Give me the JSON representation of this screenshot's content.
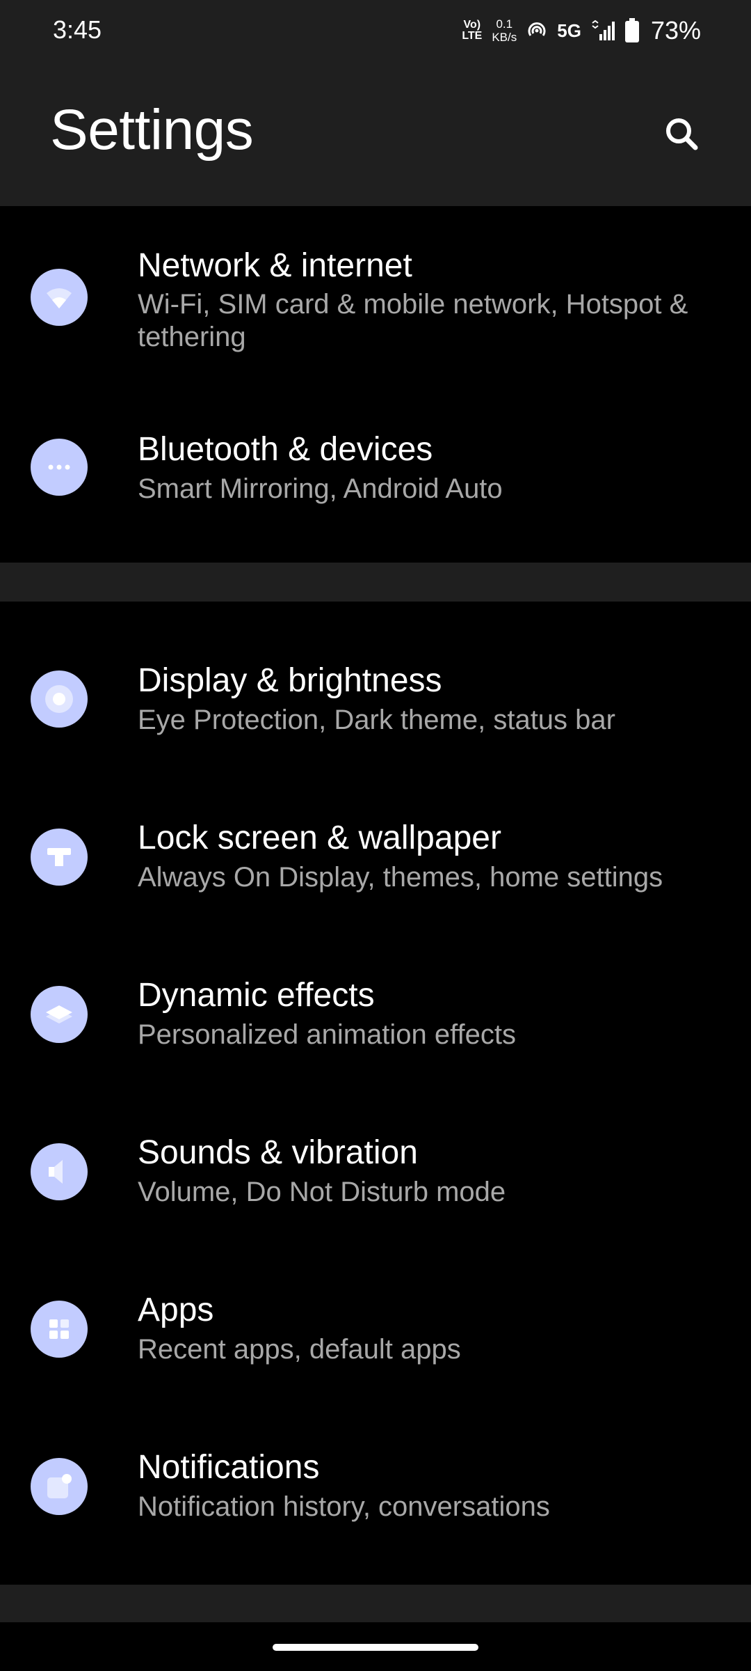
{
  "status_bar": {
    "time": "3:45",
    "volte_top": "Vo)",
    "volte_bottom": "LTE",
    "speed_value": "0.1",
    "speed_unit": "KB/s",
    "network": "5G",
    "battery": "73%"
  },
  "header": {
    "title": "Settings",
    "search_icon": "search-icon"
  },
  "settings": [
    {
      "title": "Network & internet",
      "subtitle": "Wi-Fi, SIM card & mobile network, Hotspot & tethering",
      "icon": "wifi-icon"
    },
    {
      "title": "Bluetooth & devices",
      "subtitle": "Smart Mirroring, Android Auto",
      "icon": "more-dots-icon"
    },
    {
      "title": "Display & brightness",
      "subtitle": "Eye Protection, Dark theme, status bar",
      "icon": "brightness-icon"
    },
    {
      "title": "Lock screen & wallpaper",
      "subtitle": "Always On Display, themes, home settings",
      "icon": "lock-screen-icon"
    },
    {
      "title": "Dynamic effects",
      "subtitle": "Personalized animation effects",
      "icon": "layers-icon"
    },
    {
      "title": "Sounds & vibration",
      "subtitle": "Volume, Do Not Disturb mode",
      "icon": "speaker-icon"
    },
    {
      "title": "Apps",
      "subtitle": "Recent apps, default apps",
      "icon": "apps-grid-icon"
    },
    {
      "title": "Notifications",
      "subtitle": "Notification history, conversations",
      "icon": "notification-icon"
    }
  ],
  "colors": {
    "header_bg": "#1f1f1f",
    "page_bg": "#000000",
    "icon_bg": "#c2ccff",
    "subtitle": "#a8a8a8"
  }
}
